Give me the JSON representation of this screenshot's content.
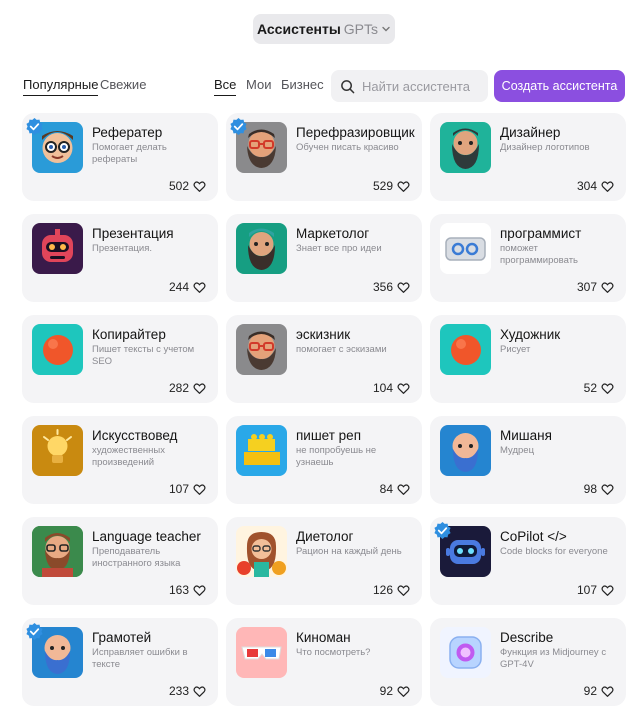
{
  "header": {
    "title_bold": "Ассистенты",
    "title_light": "GPTs"
  },
  "tabs_sort": [
    {
      "label": "Популярные",
      "active": true
    },
    {
      "label": "Свежие",
      "active": false
    }
  ],
  "tabs_filter": [
    {
      "label": "Все",
      "active": true
    },
    {
      "label": "Мои",
      "active": false
    },
    {
      "label": "Бизнес",
      "active": false
    }
  ],
  "search": {
    "placeholder": "Найти ассистента",
    "value": ""
  },
  "create_button": {
    "label": "Создать ассистента"
  },
  "colors": {
    "accent": "#8b4fe0",
    "card_bg": "#f4f4f6",
    "verified": "#2f8fe0"
  },
  "cards": [
    {
      "title": "Рефератер",
      "desc": "Помогает делать рефераты",
      "likes": "502",
      "verified": true,
      "icon": "glasses-boy-avatar"
    },
    {
      "title": "Перефразировщик",
      "desc": "Обучен писать красиво",
      "likes": "529",
      "verified": true,
      "icon": "bearded-man-avatar"
    },
    {
      "title": "Дизайнер",
      "desc": "Дизайнер логотипов",
      "likes": "304",
      "verified": false,
      "icon": "green-bearded-man-avatar"
    },
    {
      "title": "Презентация",
      "desc": "Презентация.",
      "likes": "244",
      "verified": false,
      "icon": "robot-avatar"
    },
    {
      "title": "Маркетолог",
      "desc": "Знает все про идеи",
      "likes": "356",
      "verified": false,
      "icon": "teal-bearded-man-avatar"
    },
    {
      "title": "программист",
      "desc": "поможет программировать",
      "likes": "307",
      "verified": false,
      "icon": "code-device-avatar"
    },
    {
      "title": "Копирайтер",
      "desc": "Пишет тексты с учетом SEO",
      "likes": "282",
      "verified": false,
      "icon": "orange-ball-avatar"
    },
    {
      "title": "эскизник",
      "desc": "помогает с эскизами",
      "likes": "104",
      "verified": false,
      "icon": "bearded-man-avatar"
    },
    {
      "title": "Художник",
      "desc": "Рисует",
      "likes": "52",
      "verified": false,
      "icon": "orange-ball-avatar"
    },
    {
      "title": "Искусствовед",
      "desc": "художественных произведений",
      "likes": "107",
      "verified": false,
      "icon": "lightbulb-avatar"
    },
    {
      "title": "пишет реп",
      "desc": "не попробуешь не узнаешь",
      "likes": "84",
      "verified": false,
      "icon": "lego-bricks-avatar"
    },
    {
      "title": "Мишаня",
      "desc": "Мудрец",
      "likes": "98",
      "verified": false,
      "icon": "bald-bearded-man-avatar"
    },
    {
      "title": "Language teacher",
      "desc": "Преподаватель иностранного языка",
      "likes": "163",
      "verified": false,
      "icon": "teacher-avatar"
    },
    {
      "title": "Диетолог",
      "desc": "Рацион на каждый день",
      "likes": "126",
      "verified": false,
      "icon": "woman-fruit-avatar"
    },
    {
      "title": "CoPilot </>",
      "desc": "Code blocks for everyone",
      "likes": "107",
      "verified": true,
      "icon": "copilot-robot-avatar"
    },
    {
      "title": "Грамотей",
      "desc": "Исправляет ошибки в тексте",
      "likes": "233",
      "verified": true,
      "icon": "bald-bearded-man-avatar"
    },
    {
      "title": "Киноман",
      "desc": "Что посмотреть?",
      "likes": "92",
      "verified": false,
      "icon": "3d-glasses-avatar"
    },
    {
      "title": "Describe",
      "desc": "Функция из Midjourney с GPT-4V",
      "likes": "92",
      "verified": false,
      "icon": "glowing-lens-avatar"
    }
  ]
}
